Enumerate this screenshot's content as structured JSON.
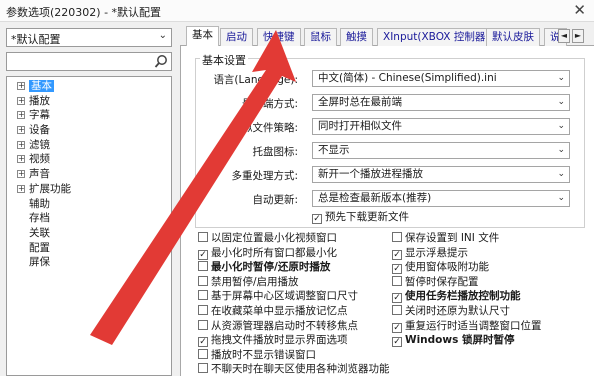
{
  "window": {
    "title": "参数选项(220302) - *默认配置",
    "close_glyph": "✕"
  },
  "left": {
    "preset": "*默认配置",
    "search_placeholder": "",
    "tree": [
      {
        "label": "基本",
        "expandable": true,
        "selected": true
      },
      {
        "label": "播放",
        "expandable": true
      },
      {
        "label": "字幕",
        "expandable": true
      },
      {
        "label": "设备",
        "expandable": true
      },
      {
        "label": "滤镜",
        "expandable": true
      },
      {
        "label": "视频",
        "expandable": true
      },
      {
        "label": "声音",
        "expandable": true
      },
      {
        "label": "扩展功能",
        "expandable": true
      },
      {
        "label": "辅助",
        "expandable": false
      },
      {
        "label": "存档",
        "expandable": false
      },
      {
        "label": "关联",
        "expandable": false
      },
      {
        "label": "配置",
        "expandable": false
      },
      {
        "label": "屏保",
        "expandable": false
      }
    ]
  },
  "tabs": [
    "基本",
    "启动",
    "快捷键",
    "鼠标",
    "触摸",
    "XInput(XBOX 控制器)",
    "默认皮肤",
    "说"
  ],
  "basic_group": {
    "legend": "基本设置",
    "rows": [
      {
        "label": "语言(Language):",
        "value": "中文(简体) - Chinese(Simplified).ini"
      },
      {
        "label": "最前端方式:",
        "value": "全屏时总在最前端"
      },
      {
        "label": "相似文件策略:",
        "value": "同时打开相似文件"
      },
      {
        "label": "托盘图标:",
        "value": "不显示"
      },
      {
        "label": "多重处理方式:",
        "value": "新开一个播放进程播放"
      },
      {
        "label": "自动更新:",
        "value": "总是检查最新版本(推荐)"
      }
    ],
    "predownload": "预先下载更新文件"
  },
  "checkboxes_left": [
    {
      "label": "以固定位置最小化视频窗口",
      "checked": false,
      "bold": false
    },
    {
      "label": "最小化时所有窗口都最小化",
      "checked": true,
      "bold": false
    },
    {
      "label": "最小化时暂停/还原时播放",
      "checked": false,
      "bold": true
    },
    {
      "label": "禁用暂停/启用播放",
      "checked": false,
      "bold": false
    },
    {
      "label": "基于屏幕中心区域调整窗口尺寸",
      "checked": false,
      "bold": false
    },
    {
      "label": "在收藏菜单中显示播放记忆点",
      "checked": false,
      "bold": false
    },
    {
      "label": "从资源管理器启动时不转移焦点",
      "checked": false,
      "bold": false
    },
    {
      "label": "拖拽文件播放时显示界面选项",
      "checked": true,
      "bold": false
    },
    {
      "label": "播放时不显示错误窗口",
      "checked": false,
      "bold": false
    },
    {
      "label": "不聊天时在聊天区使用各种浏览器功能",
      "checked": false,
      "bold": false
    }
  ],
  "checkboxes_right": [
    {
      "label": "保存设置到 INI 文件",
      "checked": false,
      "bold": false
    },
    {
      "label": "显示浮悬提示",
      "checked": true,
      "bold": false
    },
    {
      "label": "使用窗体吸附功能",
      "checked": true,
      "bold": false
    },
    {
      "label": "暂停时保存配置",
      "checked": false,
      "bold": false
    },
    {
      "label": "使用任务栏播放控制功能",
      "checked": true,
      "bold": true
    },
    {
      "label": "关闭时还原为默认尺寸",
      "checked": false,
      "bold": false
    },
    {
      "label": "重复运行时适当调整窗口位置",
      "checked": true,
      "bold": false
    },
    {
      "label": "Windows 锁屏时暂停",
      "checked": true,
      "bold": true
    }
  ]
}
